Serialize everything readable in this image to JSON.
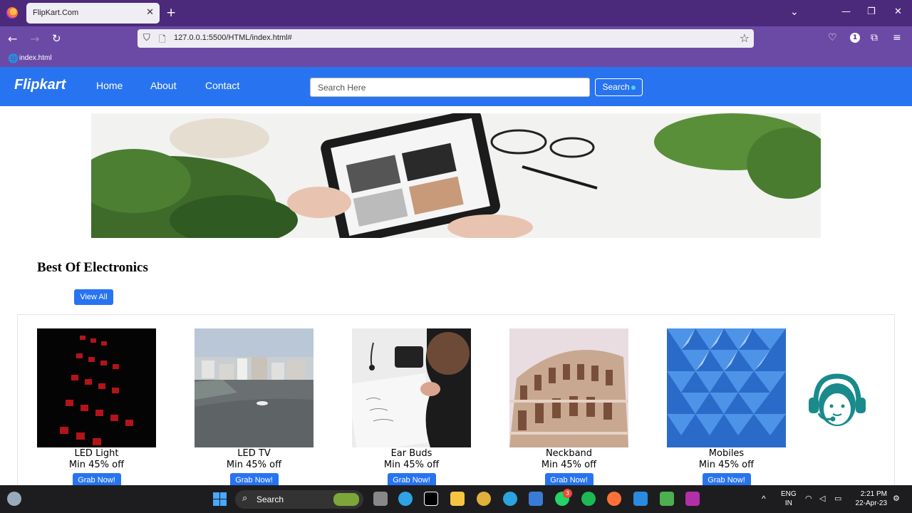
{
  "browser": {
    "tab_title": "FlipKart.Com",
    "tab_close": "✕",
    "new_tab": "+",
    "url": "127.0.0.1:5500/HTML/index.html#",
    "bookmark_label": "index.html",
    "notification_count": "1"
  },
  "site": {
    "logo": "Flipkart",
    "menu": [
      "Home",
      "About",
      "Contact"
    ],
    "search": {
      "placeholder": "Search Here",
      "button": "Search"
    },
    "brand_color": "#2874f0"
  },
  "section": {
    "title": "Best Of Electronics",
    "view_all": "View All"
  },
  "products": [
    {
      "name": "LED Light",
      "offer": "Min 45% off",
      "button": "Grab Now!"
    },
    {
      "name": "LED TV",
      "offer": "Min 45% off",
      "button": "Grab Now!"
    },
    {
      "name": "Ear Buds",
      "offer": "Min 45% off",
      "button": "Grab Now!"
    },
    {
      "name": "Neckband",
      "offer": "Min 45% off",
      "button": "Grab Now!"
    },
    {
      "name": "Mobiles",
      "offer": "Min 45% off",
      "button": "Grab Now!"
    }
  ],
  "taskbar": {
    "search_label": "Search",
    "lang_top": "ENG",
    "lang_bottom": "IN",
    "time": "2:21 PM",
    "date": "22-Apr-23",
    "whatsapp_badge": "3"
  }
}
